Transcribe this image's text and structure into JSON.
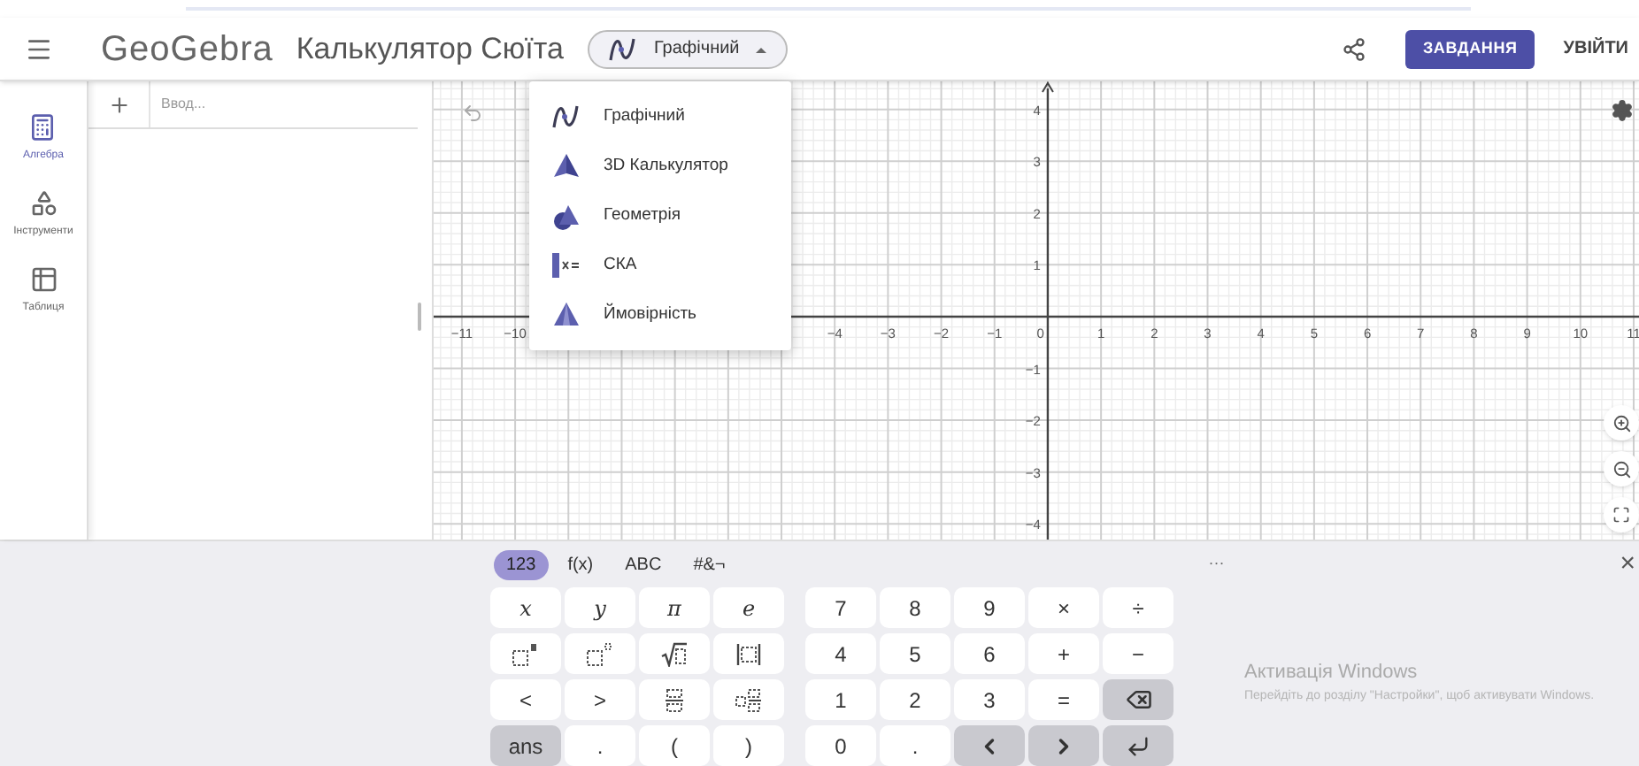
{
  "header": {
    "app_name": "GeoGebra",
    "title": "Калькулятор Сюїта",
    "app_switch": {
      "label": "Графічний",
      "expanded": true
    },
    "actions": [
      {
        "kind": "share"
      },
      {
        "kind": "primary",
        "label": "ЗАВДАННЯ"
      },
      {
        "kind": "text",
        "label": "УВІЙТИ"
      }
    ]
  },
  "app_menu": [
    {
      "kind": "graphing",
      "label": "Графічний"
    },
    {
      "kind": "solid",
      "label": "3D Калькулятор"
    },
    {
      "kind": "geometry",
      "label": "Геометрія"
    },
    {
      "kind": "cas",
      "label": "СКА"
    },
    {
      "kind": "probability",
      "label": "Ймовірність"
    }
  ],
  "sidebar": [
    {
      "kind": "algebra",
      "label": "Алгебра",
      "selected": true
    },
    {
      "kind": "tools",
      "label": "Інструменти",
      "selected": false
    },
    {
      "kind": "table",
      "label": "Таблиця",
      "selected": false
    }
  ],
  "algebra": {
    "placeholder": "Ввод..."
  },
  "graphics": {
    "chart_data": {
      "type": "line",
      "xlim": [
        -11.53,
        11.1
      ],
      "ylim": [
        -4.44,
        4.54
      ],
      "xticks": [
        -11,
        -10,
        -4,
        -3,
        -2,
        -1,
        0,
        1,
        2,
        3,
        4,
        5,
        6,
        7,
        8,
        9,
        10,
        11
      ],
      "yticks": [
        -4,
        -3,
        -2,
        -1,
        1,
        2,
        3,
        4
      ],
      "grid": true
    }
  },
  "keyboard": {
    "tabs": [
      {
        "label": "123",
        "selected": true
      },
      {
        "label": "f(x)",
        "selected": false
      },
      {
        "label": "ABC",
        "selected": false
      },
      {
        "label": "#&¬",
        "selected": false
      }
    ],
    "more": "···",
    "close": "×",
    "left": [
      {
        "kind": "var",
        "label": "x",
        "dark": false
      },
      {
        "kind": "var",
        "label": "y",
        "dark": false
      },
      {
        "kind": "var",
        "label": "π",
        "dark": false
      },
      {
        "kind": "var",
        "label": "e",
        "dark": false
      },
      {
        "kind": "square",
        "dark": false
      },
      {
        "kind": "power",
        "dark": false
      },
      {
        "kind": "sqrt",
        "dark": false
      },
      {
        "kind": "abs",
        "dark": false
      },
      {
        "kind": "text",
        "label": "<",
        "dark": false
      },
      {
        "kind": "text",
        "label": ">",
        "dark": false
      },
      {
        "kind": "fraction",
        "dark": false
      },
      {
        "kind": "mixed",
        "dark": false
      },
      {
        "kind": "text",
        "label": "ans",
        "dark": true
      },
      {
        "kind": "text",
        "label": ".",
        "dark": false
      },
      {
        "kind": "text",
        "label": "(",
        "dark": false
      },
      {
        "kind": "text",
        "label": ")",
        "dark": false
      }
    ],
    "right": [
      {
        "kind": "text",
        "label": "7",
        "dark": false
      },
      {
        "kind": "text",
        "label": "8",
        "dark": false
      },
      {
        "kind": "text",
        "label": "9",
        "dark": false
      },
      {
        "kind": "text",
        "label": "×",
        "dark": false
      },
      {
        "kind": "text",
        "label": "÷",
        "dark": false
      },
      {
        "kind": "text",
        "label": "4",
        "dark": false
      },
      {
        "kind": "text",
        "label": "5",
        "dark": false
      },
      {
        "kind": "text",
        "label": "6",
        "dark": false
      },
      {
        "kind": "text",
        "label": "+",
        "dark": false
      },
      {
        "kind": "text",
        "label": "−",
        "dark": false
      },
      {
        "kind": "text",
        "label": "1",
        "dark": false
      },
      {
        "kind": "text",
        "label": "2",
        "dark": false
      },
      {
        "kind": "text",
        "label": "3",
        "dark": false
      },
      {
        "kind": "text",
        "label": "=",
        "dark": false
      },
      {
        "kind": "backspace",
        "dark": true
      },
      {
        "kind": "text",
        "label": "0",
        "dark": false
      },
      {
        "kind": "text",
        "label": ".",
        "dark": false
      },
      {
        "kind": "left",
        "dark": true
      },
      {
        "kind": "right",
        "dark": true
      },
      {
        "kind": "enter",
        "dark": true
      }
    ]
  },
  "os_notice": {
    "title": "Активація Windows",
    "text": "Перейдіть до розділу \"Настройки\", щоб активувати Windows."
  }
}
